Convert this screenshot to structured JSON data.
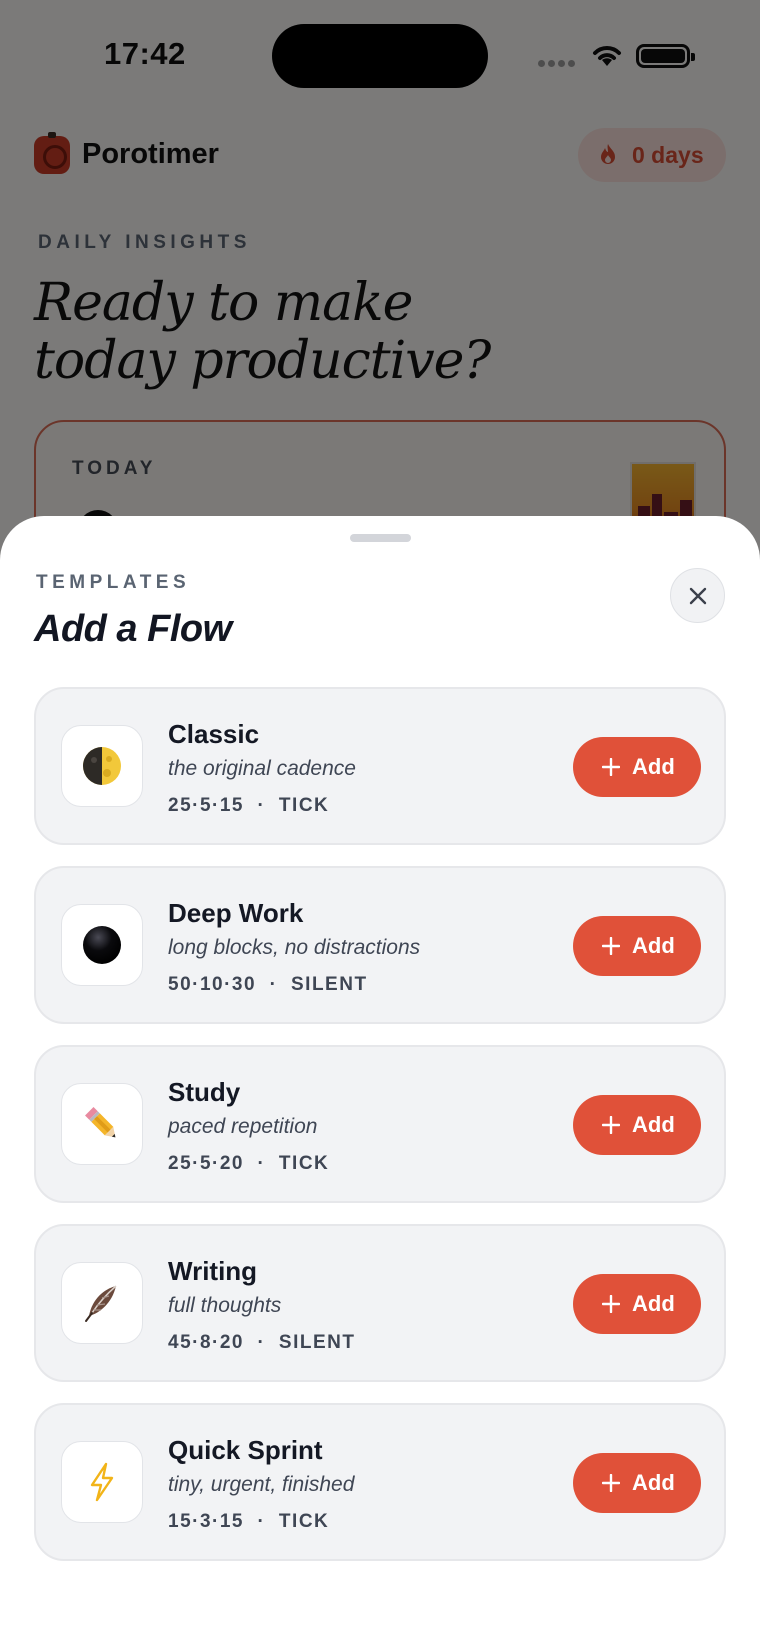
{
  "status_bar": {
    "time": "17:42"
  },
  "app": {
    "name": "Porotimer",
    "streak_label": "0 days",
    "eyebrow": "DAILY INSIGHTS",
    "headline": [
      "Ready to make",
      "today productive?"
    ],
    "today_label": "TODAY"
  },
  "sheet": {
    "eyebrow": "TEMPLATES",
    "title": "Add a Flow",
    "templates": [
      {
        "name": "Classic",
        "description": "the original cadence",
        "meta": "25·5·15  ·  TICK",
        "icon": "half-moon-icon",
        "add_label": "Add"
      },
      {
        "name": "Deep Work",
        "description": "long blocks, no distractions",
        "meta": "50·10·30  ·  SILENT",
        "icon": "black-circle-icon",
        "add_label": "Add"
      },
      {
        "name": "Study",
        "description": "paced repetition",
        "meta": "25·5·20  ·  TICK",
        "icon": "pencil-icon",
        "add_label": "Add"
      },
      {
        "name": "Writing",
        "description": "full thoughts",
        "meta": "45·8·20  ·  SILENT",
        "icon": "feather-icon",
        "add_label": "Add"
      },
      {
        "name": "Quick Sprint",
        "description": "tiny, urgent, finished",
        "meta": "15·3·15  ·  TICK",
        "icon": "lightning-icon",
        "add_label": "Add"
      }
    ]
  },
  "colors": {
    "accent": "#e05139",
    "streak_text": "#d24a33",
    "card_bg": "#f2f3f5"
  }
}
